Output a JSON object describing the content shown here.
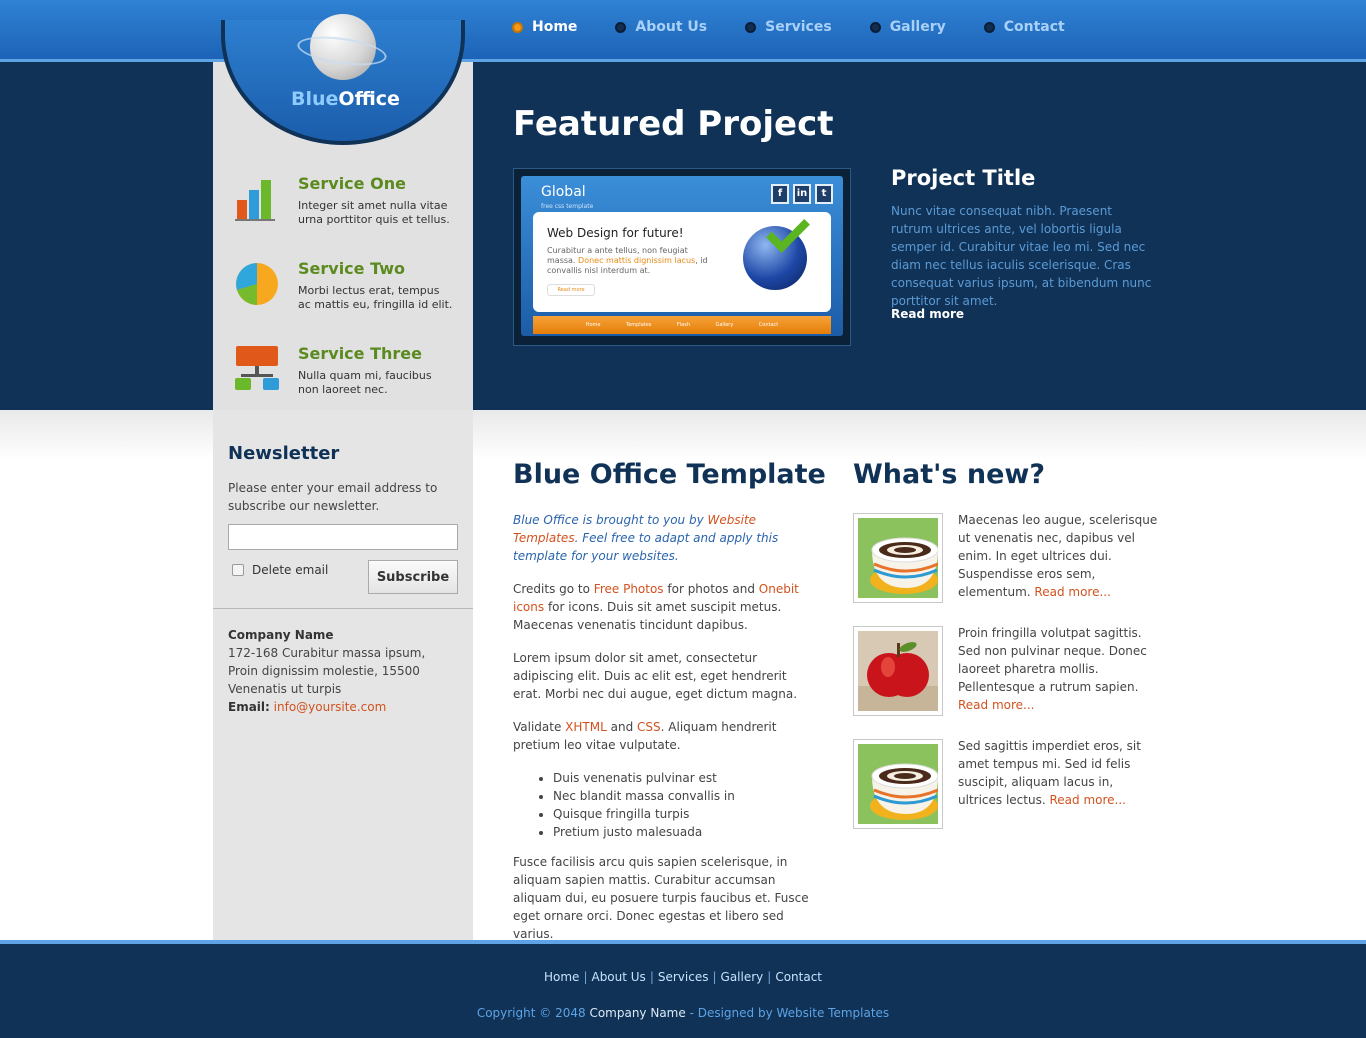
{
  "colors": {
    "accent": "#1d63b7",
    "dark": "#0f3256",
    "green": "#5b8a1f",
    "link": "#d2521f"
  },
  "logo": {
    "part1": "Blue",
    "part2": "Office"
  },
  "nav": [
    {
      "label": "Home",
      "active": true
    },
    {
      "label": "About Us",
      "active": false
    },
    {
      "label": "Services",
      "active": false
    },
    {
      "label": "Gallery",
      "active": false
    },
    {
      "label": "Contact",
      "active": false
    }
  ],
  "services": [
    {
      "title": "Service One",
      "text": "Integer sit amet nulla vitae urna porttitor quis et tellus.",
      "icon": "bar-chart-icon"
    },
    {
      "title": "Service Two",
      "text": "Morbi lectus erat, tempus ac mattis eu, fringilla id elit.",
      "icon": "pie-chart-icon"
    },
    {
      "title": "Service Three",
      "text": "Nulla quam mi, faucibus non laoreet nec.",
      "icon": "network-icon"
    }
  ],
  "featured": {
    "heading": "Featured Project",
    "thumb": {
      "title": "Global",
      "subtitle": "free css template",
      "card_title": "Web Design for future!",
      "card_text_1": "Curabitur a ante tellus, non feugiat massa.",
      "card_text_hl": "Donec mattis dignissim lacus",
      "card_text_2": ", id convallis nisl interdum at.",
      "read_more": "Read more",
      "nav": [
        "Home",
        "Templates",
        "Flash",
        "Gallery",
        "Contact"
      ]
    },
    "project_title": "Project Title",
    "project_text": "Nunc vitae consequat nibh. Praesent rutrum ultrices ante, vel lobortis ligula semper id. Curabitur vitae leo mi. Sed nec diam nec tellus iaculis scelerisque. Cras consequat varius ipsum, at bibendum nunc porttitor sit amet.",
    "read_more": "Read more"
  },
  "newsletter": {
    "title": "Newsletter",
    "text": "Please enter your email address to subscribe our newsletter.",
    "input_value": "",
    "checkbox_label": "Delete email",
    "button": "Subscribe"
  },
  "company": {
    "name": "Company Name",
    "address1": "172-168 Curabitur massa ipsum,",
    "address2": "Proin dignissim molestie, 15500",
    "address3": "Venenatis ut turpis",
    "email_label": "Email:",
    "email": "info@yoursite.com"
  },
  "main": {
    "title": "Blue Office Template",
    "intro_1": "Blue Office is brought to you by ",
    "intro_link": "Website Templates",
    "intro_2": ". Feel free to adapt and apply this template for your websites.",
    "credits_1": "Credits go to ",
    "credits_link1": "Free Photos",
    "credits_2": " for photos and ",
    "credits_link2": "Onebit icons",
    "credits_3": " for icons. Duis sit amet suscipit metus. Maecenas venenatis tincidunt dapibus.",
    "lorem": "Lorem ipsum dolor sit amet, consectetur adipiscing elit. Duis ac elit est, eget hendrerit erat. Morbi nec dui augue, eget dictum magna.",
    "validate_1": "Validate ",
    "validate_xhtml": "XHTML",
    "validate_and": " and ",
    "validate_css": "CSS",
    "validate_2": ". Aliquam hendrerit pretium leo vitae vulputate.",
    "bullets": [
      "Duis venenatis pulvinar est",
      "Nec blandit massa convallis in",
      "Quisque fringilla turpis",
      "Pretium justo malesuada"
    ],
    "closing": "Fusce facilisis arcu quis sapien scelerisque, in aliquam sapien mattis. Curabitur accumsan aliquam dui, eu posuere turpis faucibus et. Fusce eget ornare orci. Donec egestas et libero sed varius."
  },
  "news": {
    "title": "What's new?",
    "items": [
      {
        "text": "Maecenas leo augue, scelerisque ut venenatis nec, dapibus vel enim. In eget ultrices dui. Suspendisse eros sem, elementum.",
        "link": "Read more...",
        "image": "coffee-cup"
      },
      {
        "text": "Proin fringilla volutpat sagittis. Sed non pulvinar neque. Donec laoreet pharetra mollis. Pellentesque a rutrum sapien.",
        "link": "Read more...",
        "image": "apple"
      },
      {
        "text": "Sed sagittis imperdiet eros, sit amet tempus mi. Sed id felis suscipit, aliquam lacus in, ultrices lectus.",
        "link": "Read more...",
        "image": "coffee-cup"
      }
    ]
  },
  "footer": {
    "nav": [
      "Home",
      "About Us",
      "Services",
      "Gallery",
      "Contact"
    ],
    "copy_1": "Copyright © 2048 ",
    "copy_company": "Company Name",
    "copy_2": " - Designed by ",
    "copy_designer": "Website Templates"
  }
}
